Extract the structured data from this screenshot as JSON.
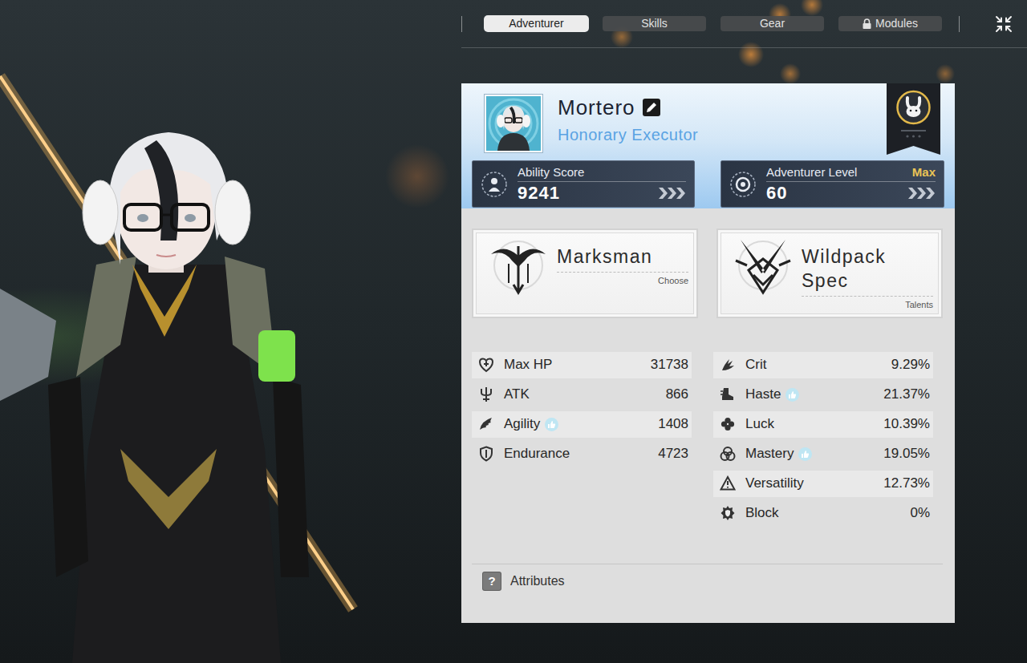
{
  "tabs": [
    {
      "label": "Adventurer",
      "selected": true,
      "locked": false
    },
    {
      "label": "Skills",
      "selected": false,
      "locked": false
    },
    {
      "label": "Gear",
      "selected": false,
      "locked": false
    },
    {
      "label": "Modules",
      "selected": false,
      "locked": true
    }
  ],
  "profile": {
    "name": "Mortero",
    "title": "Honorary Executor"
  },
  "ability_score": {
    "label": "Ability Score",
    "value": "9241"
  },
  "level": {
    "label": "Adventurer Level",
    "tag": "Max",
    "value": "60"
  },
  "classes": [
    {
      "name": "Marksman",
      "action": "Choose"
    },
    {
      "name": "Wildpack Spec",
      "action": "Talents"
    }
  ],
  "stats_left": [
    {
      "label": "Max HP",
      "value": "31738",
      "recommended": false
    },
    {
      "label": "ATK",
      "value": "866",
      "recommended": false
    },
    {
      "label": "Agility",
      "value": "1408",
      "recommended": true
    },
    {
      "label": "Endurance",
      "value": "4723",
      "recommended": false
    }
  ],
  "stats_right": [
    {
      "label": "Crit",
      "value": "9.29%",
      "recommended": false
    },
    {
      "label": "Haste",
      "value": "21.37%",
      "recommended": true
    },
    {
      "label": "Luck",
      "value": "10.39%",
      "recommended": false
    },
    {
      "label": "Mastery",
      "value": "19.05%",
      "recommended": true
    },
    {
      "label": "Versatility",
      "value": "12.73%",
      "recommended": false
    },
    {
      "label": "Block",
      "value": "0%",
      "recommended": false
    }
  ],
  "footer": {
    "icon": "?",
    "label": "Attributes"
  }
}
